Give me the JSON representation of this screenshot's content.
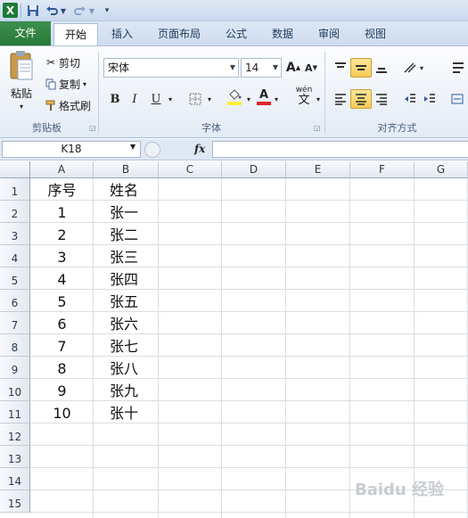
{
  "quick_access": {
    "save_icon": "save-icon",
    "undo_icon": "undo-icon",
    "redo_icon": "redo-icon",
    "app_icon": "X"
  },
  "tabs": [
    "文件",
    "开始",
    "插入",
    "页面布局",
    "公式",
    "数据",
    "审阅",
    "视图"
  ],
  "clipboard": {
    "paste": "粘贴",
    "cut": "剪切",
    "copy": "复制",
    "format_painter": "格式刷",
    "group": "剪贴板"
  },
  "font": {
    "name": "宋体",
    "size": "14",
    "bold": "B",
    "italic": "I",
    "underline": "U",
    "grow": "A",
    "shrink": "A",
    "color_glyph": "A",
    "phonetic": "wén",
    "phonetic_sub": "文",
    "group": "字体"
  },
  "alignment": {
    "group": "对齐方式"
  },
  "formula_bar": {
    "name_box": "K18",
    "fx": "fx",
    "value": ""
  },
  "columns": [
    "A",
    "B",
    "C",
    "D",
    "E",
    "F",
    "G"
  ],
  "rows": [
    "1",
    "2",
    "3",
    "4",
    "5",
    "6",
    "7",
    "8",
    "9",
    "10",
    "11",
    "12",
    "13",
    "14",
    "15"
  ],
  "cells": [
    {
      "a": "序号",
      "b": "姓名"
    },
    {
      "a": "1",
      "b": "张一"
    },
    {
      "a": "2",
      "b": "张二"
    },
    {
      "a": "3",
      "b": "张三"
    },
    {
      "a": "4",
      "b": "张四"
    },
    {
      "a": "5",
      "b": "张五"
    },
    {
      "a": "6",
      "b": "张六"
    },
    {
      "a": "7",
      "b": "张七"
    },
    {
      "a": "8",
      "b": "张八"
    },
    {
      "a": "9",
      "b": "张九"
    },
    {
      "a": "10",
      "b": "张十"
    }
  ],
  "watermark": "Baidu 经验",
  "colors": {
    "file_tab": "#2a7a3a",
    "accent_blue": "#1e395b",
    "active_button": "#f8cc55",
    "underline_red": "#e0262a",
    "fill_yellow": "#ffef3a"
  }
}
